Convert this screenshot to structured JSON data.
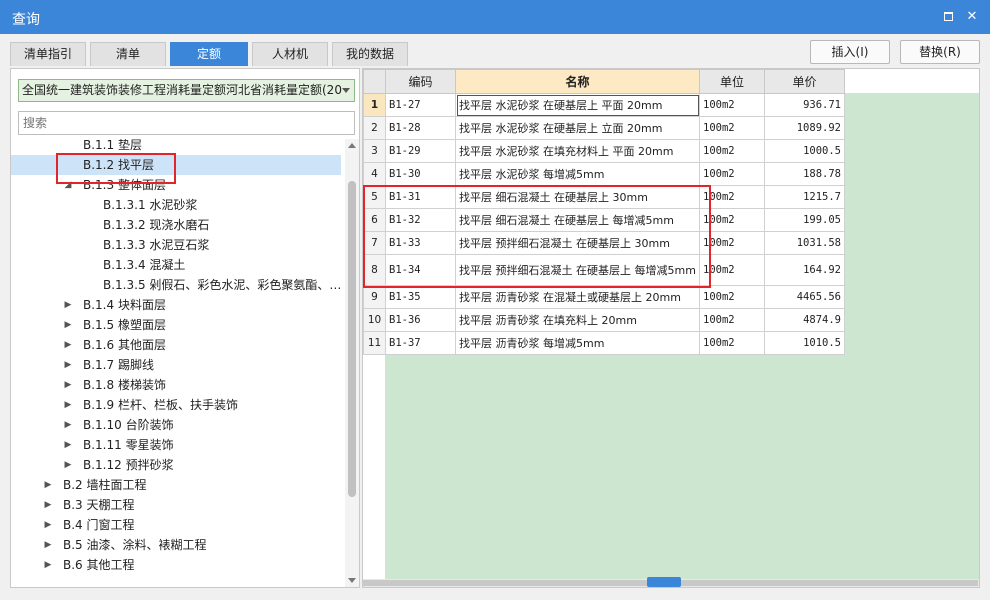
{
  "window": {
    "title": "查询"
  },
  "tabs": [
    {
      "label": "清单指引",
      "active": false
    },
    {
      "label": "清单",
      "active": false
    },
    {
      "label": "定额",
      "active": true
    },
    {
      "label": "人材机",
      "active": false
    },
    {
      "label": "我的数据",
      "active": false
    }
  ],
  "buttons": {
    "insert": "插入(I)",
    "replace": "替换(R)"
  },
  "left": {
    "dropdown_value": "全国统一建筑装饰装修工程消耗量定额河北省消耗量定额(20",
    "search_placeholder": "搜索",
    "tree": [
      {
        "label": "B.1.1 垫层",
        "level": 2,
        "expander": "none"
      },
      {
        "label": "B.1.2 找平层",
        "level": 2,
        "expander": "none",
        "selected": true
      },
      {
        "label": "B.1.3 整体面层",
        "level": 2,
        "expander": "expanded"
      },
      {
        "label": "B.1.3.1 水泥砂浆",
        "level": 3,
        "expander": "none"
      },
      {
        "label": "B.1.3.2 现浇水磨石",
        "level": 3,
        "expander": "none"
      },
      {
        "label": "B.1.3.3 水泥豆石浆",
        "level": 3,
        "expander": "none"
      },
      {
        "label": "B.1.3.4 混凝土",
        "level": 3,
        "expander": "none"
      },
      {
        "label": "B.1.3.5 剁假石、彩色水泥、彩色聚氨酯、…",
        "level": 3,
        "expander": "none"
      },
      {
        "label": "B.1.4 块料面层",
        "level": 2,
        "expander": "collapsed"
      },
      {
        "label": "B.1.5 橡塑面层",
        "level": 2,
        "expander": "collapsed"
      },
      {
        "label": "B.1.6 其他面层",
        "level": 2,
        "expander": "collapsed"
      },
      {
        "label": "B.1.7 踢脚线",
        "level": 2,
        "expander": "collapsed"
      },
      {
        "label": "B.1.8 楼梯装饰",
        "level": 2,
        "expander": "collapsed"
      },
      {
        "label": "B.1.9 栏杆、栏板、扶手装饰",
        "level": 2,
        "expander": "collapsed"
      },
      {
        "label": "B.1.10 台阶装饰",
        "level": 2,
        "expander": "collapsed"
      },
      {
        "label": "B.1.11 零星装饰",
        "level": 2,
        "expander": "collapsed"
      },
      {
        "label": "B.1.12 预拌砂浆",
        "level": 2,
        "expander": "collapsed"
      },
      {
        "label": "B.2 墙柱面工程",
        "level": 1,
        "expander": "collapsed"
      },
      {
        "label": "B.3 天棚工程",
        "level": 1,
        "expander": "collapsed"
      },
      {
        "label": "B.4 门窗工程",
        "level": 1,
        "expander": "collapsed"
      },
      {
        "label": "B.5 油漆、涂料、裱糊工程",
        "level": 1,
        "expander": "collapsed"
      },
      {
        "label": "B.6 其他工程",
        "level": 1,
        "expander": "collapsed"
      }
    ]
  },
  "grid": {
    "headers": [
      "编码",
      "名称",
      "单位",
      "单价"
    ],
    "rows": [
      [
        "1",
        "B1-27",
        "找平层 水泥砂浆 在硬基层上 平面 20mm",
        "100m2",
        "936.71"
      ],
      [
        "2",
        "B1-28",
        "找平层 水泥砂浆 在硬基层上 立面 20mm",
        "100m2",
        "1089.92"
      ],
      [
        "3",
        "B1-29",
        "找平层 水泥砂浆 在填充材料上 平面 20mm",
        "100m2",
        "1000.5"
      ],
      [
        "4",
        "B1-30",
        "找平层 水泥砂浆 每增减5mm",
        "100m2",
        "188.78"
      ],
      [
        "5",
        "B1-31",
        "找平层 细石混凝土 在硬基层上 30mm",
        "100m2",
        "1215.7"
      ],
      [
        "6",
        "B1-32",
        "找平层 细石混凝土 在硬基层上 每增减5mm",
        "100m2",
        "199.05"
      ],
      [
        "7",
        "B1-33",
        "找平层 预拌细石混凝土 在硬基层上 30mm",
        "100m2",
        "1031.58"
      ],
      [
        "8",
        "B1-34",
        "找平层 预拌细石混凝土 在硬基层上 每增减5mm",
        "100m2",
        "164.92"
      ],
      [
        "9",
        "B1-35",
        "找平层 沥青砂浆 在混凝土或硬基层上 20mm",
        "100m2",
        "4465.56"
      ],
      [
        "10",
        "B1-36",
        "找平层 沥青砂浆 在填充料上 20mm",
        "100m2",
        "4874.9"
      ],
      [
        "11",
        "B1-37",
        "找平层 沥青砂浆 每增减5mm",
        "100m2",
        "1010.5"
      ]
    ]
  },
  "colors": {
    "accent": "#3b86d9",
    "highlight_box": "#e0262b",
    "grid_empty": "#cce6cf"
  }
}
